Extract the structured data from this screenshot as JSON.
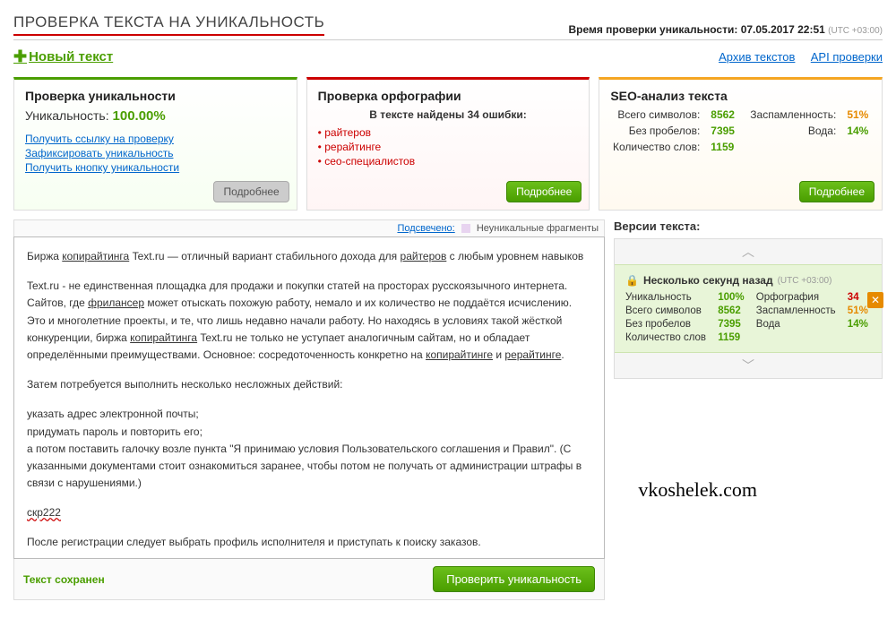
{
  "header": {
    "title": "ПРОВЕРКА ТЕКСТА НА УНИКАЛЬНОСТЬ",
    "check_time_label": "Время проверки уникальности:",
    "check_time_value": "07.05.2017 22:51",
    "tz": "(UTC +03:00)"
  },
  "links": {
    "new_text": "Новый текст",
    "archive": "Архив текстов",
    "api": "API проверки"
  },
  "panel_uniq": {
    "title": "Проверка уникальности",
    "label": "Уникальность:",
    "value": "100.00%",
    "link1": "Получить ссылку на проверку",
    "link2": "Зафиксировать уникальность",
    "link3": "Получить кнопку уникальности",
    "more": "Подробнее"
  },
  "panel_spell": {
    "title": "Проверка орфографии",
    "sub": "В тексте найдены 34 ошибки:",
    "items": [
      "райтеров",
      "рерайтинге",
      "сео-специалистов"
    ],
    "more": "Подробнее"
  },
  "panel_seo": {
    "title": "SEO-анализ текста",
    "rows": {
      "total_chars_l": "Всего символов:",
      "total_chars_v": "8562",
      "spam_l": "Заспамленность:",
      "spam_v": "51%",
      "no_spaces_l": "Без пробелов:",
      "no_spaces_v": "7395",
      "water_l": "Вода:",
      "water_v": "14%",
      "words_l": "Количество слов:",
      "words_v": "1159"
    },
    "more": "Подробнее"
  },
  "legend": {
    "link": "Подсвечено:",
    "label": "Неуникальные фрагменты"
  },
  "editor": {
    "p1a": "Биржа ",
    "p1b": "копирайтинга",
    "p1c": " Text.ru — отличный вариант стабильного дохода для ",
    "p1d": "райтеров",
    "p1e": " с любым уровнем навыков",
    "p2a": "Text.ru - не единственная площадка для продажи и покупки статей на просторах русскоязычного интернета. Сайтов, где ",
    "p2b": "фрилансер",
    "p2c": " может отыскать похожую работу, немало и их количество не поддаётся исчислению. Это и многолетние проекты, и те, что лишь недавно начали работу. Но находясь в условиях такой жёсткой конкуренции, биржа ",
    "p2d": "копирайтинга",
    "p2e": " Text.ru не только не уступает аналогичным сайтам, но и обладает определёнными преимуществами. Основное: сосредоточенность конкретно на ",
    "p2f": "копирайтинге",
    "p2g": " и ",
    "p2h": "рерайтинге",
    "p2i": ".",
    "p3": "Затем потребуется выполнить несколько несложных действий:",
    "p4": "указать адрес электронной почты;\nпридумать пароль и повторить его;\nа потом поставить галочку возле пункта \"Я принимаю условия Пользовательского соглашения и Правил\". (С указанными документами стоит ознакомиться заранее, чтобы потом не получать от администрации штрафы в связи с нарушениями.)",
    "p5": "скр222",
    "p6": "После регистрации следует выбрать профиль исполнителя и приступать к поиску заказов."
  },
  "footer": {
    "saved": "Текст сохранен",
    "check": "Проверить уникальность"
  },
  "versions": {
    "title": "Версии текста:",
    "item_title": "Несколько секунд назад",
    "tz": "(UTC +03:00)",
    "rows": {
      "uniq_l": "Уникальность",
      "uniq_v": "100%",
      "spell_l": "Орфография",
      "spell_v": "34",
      "chars_l": "Всего символов",
      "chars_v": "8562",
      "spam_l": "Заспамленность",
      "spam_v": "51%",
      "nosp_l": "Без пробелов",
      "nosp_v": "7395",
      "water_l": "Вода",
      "water_v": "14%",
      "words_l": "Количество слов",
      "words_v": "1159"
    }
  },
  "watermark": "vkoshelek.com"
}
